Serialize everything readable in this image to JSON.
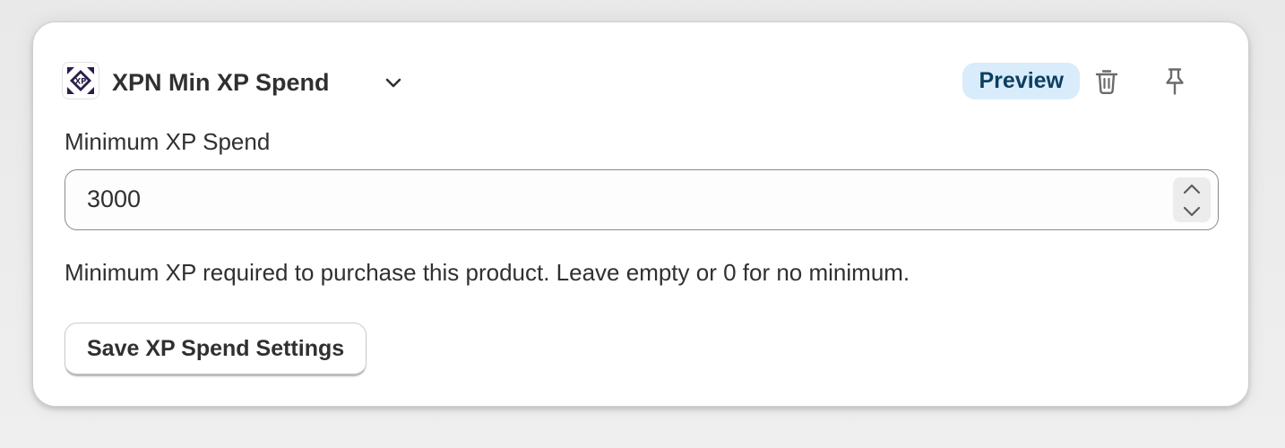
{
  "block": {
    "app_logo_icon": "xp-logo-icon",
    "title": "XPN Min XP Spend",
    "expand_icon": "chevron-down-icon",
    "badge": "Preview",
    "delete_icon": "trash-icon",
    "pin_icon": "pin-icon"
  },
  "field": {
    "label": "Minimum XP Spend",
    "value": "3000",
    "step_up_icon": "chevron-up-icon",
    "step_down_icon": "chevron-down-icon",
    "help_text": "Minimum XP required to purchase this product. Leave empty or 0 for no minimum."
  },
  "actions": {
    "save_label": "Save XP Spend Settings"
  },
  "colors": {
    "badge_background": "#d9ecfb",
    "badge_text": "#0c3f60",
    "logo_dark": "#2b1d4a",
    "text": "#303030"
  }
}
